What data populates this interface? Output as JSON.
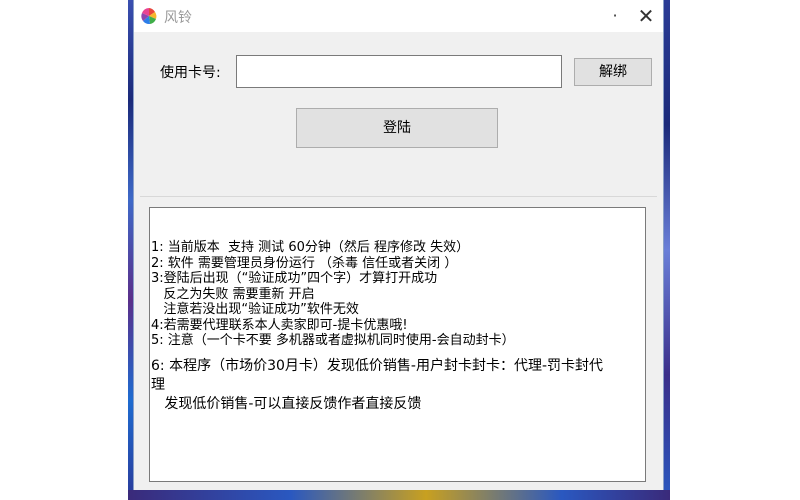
{
  "window": {
    "title": "风铃",
    "minimize_glyph": "·",
    "close_glyph": "✕"
  },
  "form": {
    "card_label": "使用卡号:",
    "card_value": "",
    "card_placeholder": "",
    "unbind_label": "解绑",
    "login_label": "登陆"
  },
  "notice": {
    "lines": [
      "1: 当前版本  支持 测试 60分钟（然后 程序修改 失效）",
      "2: 软件 需要管理员身份运行 （杀毒 信任或者关闭 ）",
      "3:登陆后出现（“验证成功”四个字）才算打开成功",
      "   反之为失败 需要重新 开启",
      "   注意若没出现“验证成功”软件无效",
      "4:若需要代理联系本人卖家即可-提卡优惠哦!",
      "5: 注意（一个卡不要 多机器或者虚拟机同时使用-会自动封卡）"
    ],
    "para6_line1": "6: 本程序（市场价30月卡）发现低价销售-用户封卡封卡：代理-罚卡封代",
    "para6_line2": "理",
    "para6_line3": "   发现低价销售-可以直接反馈作者直接反馈"
  },
  "icons": {
    "app_icon": "pinwheel-icon"
  }
}
